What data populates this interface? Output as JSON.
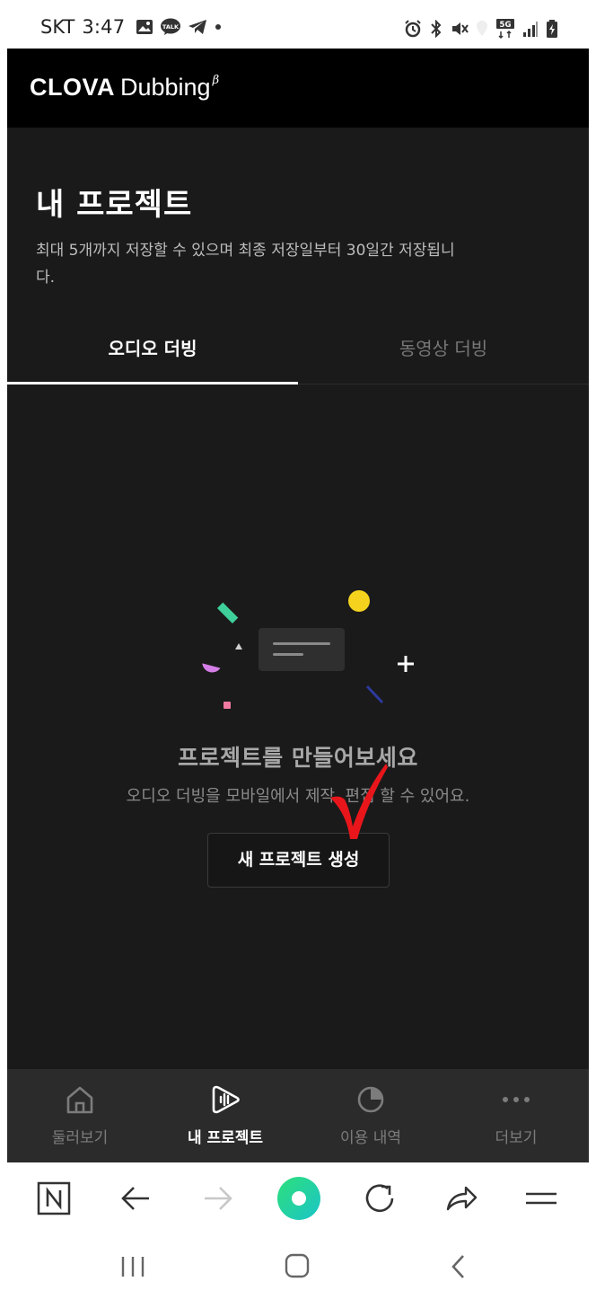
{
  "status_bar": {
    "carrier": "SKT",
    "time": "3:47",
    "left_icons": [
      "gallery-icon",
      "kakaotalk-icon",
      "telegram-icon",
      "dot-icon"
    ],
    "kakao_badge": "TALK",
    "network": "5G",
    "right_icons": [
      "alarm-icon",
      "bluetooth-icon",
      "mute-icon",
      "location-icon",
      "signal-icon",
      "battery-icon"
    ]
  },
  "header": {
    "logo_clova": "CLOVA",
    "logo_dubbing": "Dubbing",
    "logo_beta": "β"
  },
  "page": {
    "title": "내 프로젝트",
    "description": "최대 5개까지 저장할 수 있으며 최종 저장일부터 30일간 저장됩니다."
  },
  "tabs": [
    {
      "label": "오디오 더빙",
      "active": true
    },
    {
      "label": "동영상 더빙",
      "active": false
    }
  ],
  "empty_state": {
    "title": "프로젝트를 만들어보세요",
    "subtitle": "오디오 더빙을 모바일에서 제작, 편집 할 수 있어요.",
    "button_label": "새 프로젝트 생성"
  },
  "bottom_nav": [
    {
      "label": "둘러보기",
      "icon": "home-icon",
      "active": false
    },
    {
      "label": "내 프로젝트",
      "icon": "project-play-icon",
      "active": true
    },
    {
      "label": "이용 내역",
      "icon": "pie-chart-icon",
      "active": false
    },
    {
      "label": "더보기",
      "icon": "more-dots-icon",
      "active": false
    }
  ],
  "browser_toolbar": [
    "naver-home-icon",
    "back-arrow-icon",
    "forward-arrow-icon",
    "green-dot-button",
    "refresh-icon",
    "share-icon",
    "menu-icon"
  ],
  "system_nav": [
    "recent-apps-icon",
    "home-button-icon",
    "back-icon"
  ],
  "colors": {
    "background": "#1a1a1a",
    "header": "#000000",
    "nav_background": "#2b2b2b",
    "annotation": "#e8161b",
    "accent_green": "#25d79d"
  }
}
